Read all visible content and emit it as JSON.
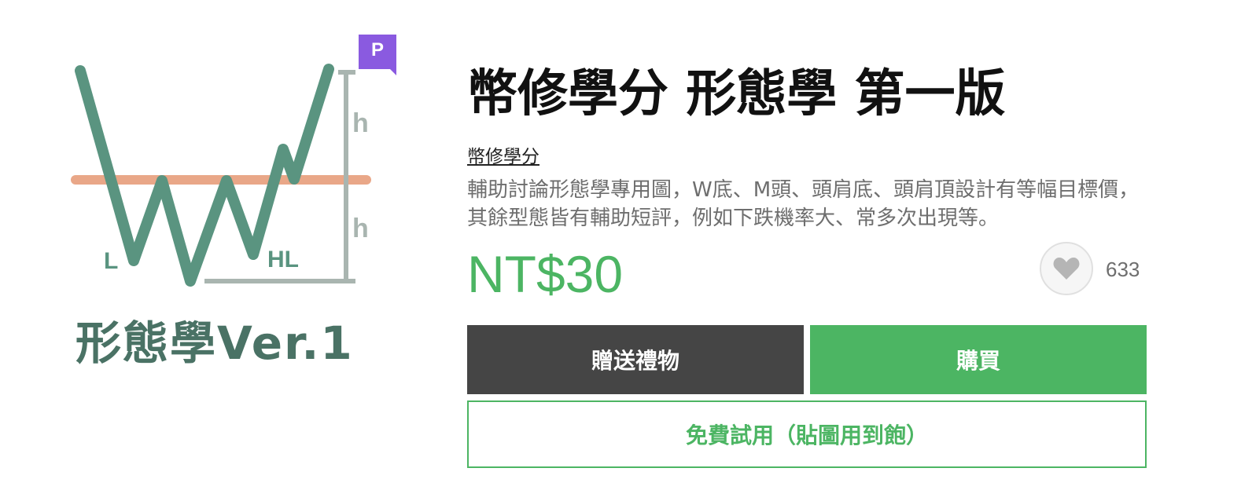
{
  "product": {
    "title": "幣修學分 形態學 第一版",
    "author": "幣修學分",
    "description": "輔助討論形態學專用圖，W底、M頭、頭肩底、頭肩頂設計有等幅目標價，其餘型態皆有輔助短評，例如下跌機率大、常多次出現等。",
    "price": "NT$30",
    "like_count": "633"
  },
  "thumbnail": {
    "logo_text": "形態學Ver.1",
    "labels": {
      "left_low": "L",
      "higher_low": "HL",
      "height_top": "h",
      "height_bottom": "h"
    },
    "badge": "P"
  },
  "buttons": {
    "gift": "贈送禮物",
    "buy": "購買",
    "trial": "免費試用（貼圖用到飽）"
  },
  "colors": {
    "accent_green": "#4cb563",
    "dark_button": "#454545",
    "premium_purple": "#8a5ae0",
    "chart_line": "#5a9480",
    "neckline": "#e9a788",
    "measure_gray": "#a9b5b0"
  },
  "icons": {
    "like": "heart-icon",
    "badge": "premium-badge-icon"
  }
}
